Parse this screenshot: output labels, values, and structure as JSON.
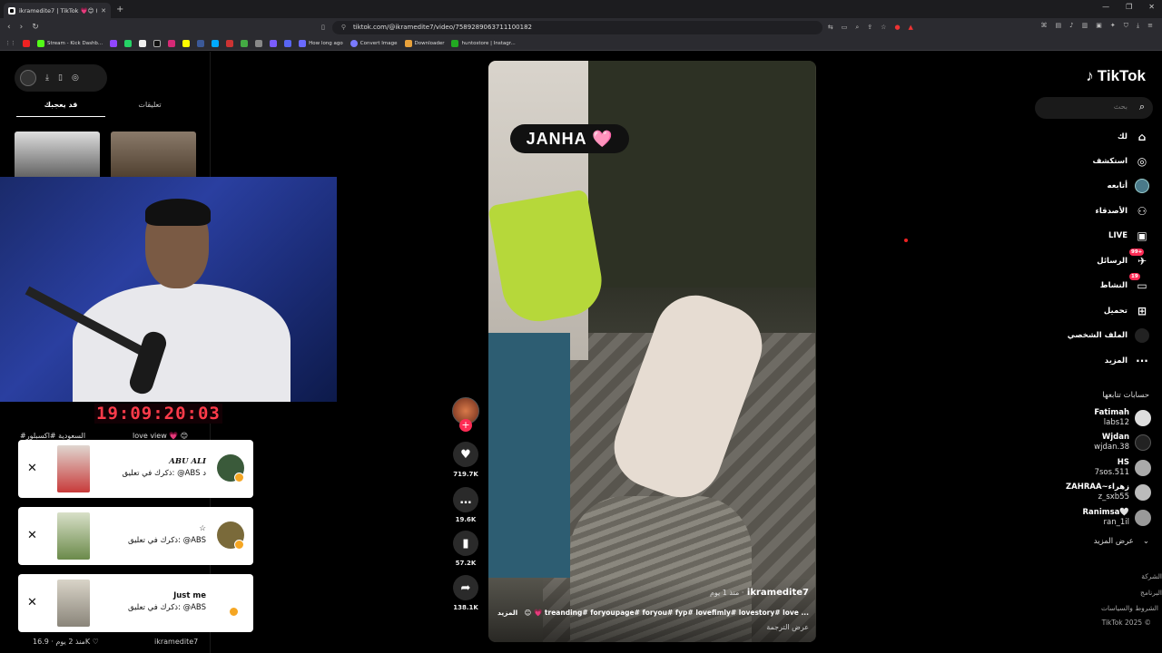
{
  "browser": {
    "tab_title": "ikramedite7 | TikTok 💗😊 (+99)",
    "url": "tiktok.com/@ikramedite7/video/7589289063711100182",
    "bookmarks": [
      "Stream - Kick Dashb...",
      "How long ago",
      "Convert Image",
      "Downloader",
      "huntostore | Instagr..."
    ]
  },
  "left_panel": {
    "tabs": [
      "قد يعجبك",
      "تعليقات"
    ],
    "timer": "19:09:20:03",
    "hashtags_left": "#السعودية #اكسبلور",
    "hashtags_right": "love view 💗 😊",
    "notifications": [
      {
        "name": "ABU ALI",
        "text": "ذكرك في تعليق: @ABS د",
        "thumb_color": "#c83a3a"
      },
      {
        "name": "☆",
        "text": "ذكرك في تعليق: @ABS",
        "thumb_color": "#6b8a4a"
      },
      {
        "name": "Just me",
        "text": "ذكرك في تعليق: @ABS",
        "thumb_color": "#b9b3a5"
      }
    ],
    "bottom_likes": "16.9K ♡",
    "bottom_ago": "منذ 2 يوم ·",
    "bottom_user": "ikramedite7"
  },
  "video": {
    "overlay_text": "JANHA 🩷",
    "username": "ikramedite7",
    "ago": "منذ 1 يوم ·",
    "caption": "😊 💗 treanding# foryoupage# foryou# fyp# lovefimly# lovestory# love ...",
    "more": "المزيد",
    "translate": "عرض الترجمة"
  },
  "actions": {
    "likes": "719.7K",
    "comments": "19.6K",
    "saves": "57.2K",
    "shares": "138.1K"
  },
  "sidebar": {
    "logo": "TikTok",
    "search_placeholder": "بحث",
    "nav": [
      {
        "label": "لك",
        "icon": "home-icon"
      },
      {
        "label": "استكشف",
        "icon": "compass-icon"
      },
      {
        "label": "أتابعه",
        "icon": "following-icon"
      },
      {
        "label": "الأصدقاء",
        "icon": "friends-icon"
      },
      {
        "label": "LIVE",
        "icon": "live-icon"
      },
      {
        "label": "الرسائل",
        "icon": "inbox-icon",
        "badge": "99+"
      },
      {
        "label": "النشاط",
        "icon": "activity-icon",
        "badge": "19"
      },
      {
        "label": "تحميل",
        "icon": "upload-icon"
      },
      {
        "label": "الملف الشخصي",
        "icon": "profile-icon"
      },
      {
        "label": "المزيد",
        "icon": "more-icon"
      }
    ],
    "following_title": "حسابات تتابعها",
    "following": [
      {
        "name": "Fatimah",
        "handle": "labs12"
      },
      {
        "name": "Wjdan",
        "handle": "wjdan.38"
      },
      {
        "name": "HS",
        "handle": "7sos.511"
      },
      {
        "name": "ZAHRAA~زهراء",
        "handle": "z_sxb55"
      },
      {
        "name": "Ranimsa🤍",
        "handle": "ran_1il"
      }
    ],
    "see_more": "عرض المزيد",
    "footer": [
      "الشركة",
      "البرنامج",
      "الشروط والسياسات",
      "TikTok 2025 ©"
    ]
  }
}
